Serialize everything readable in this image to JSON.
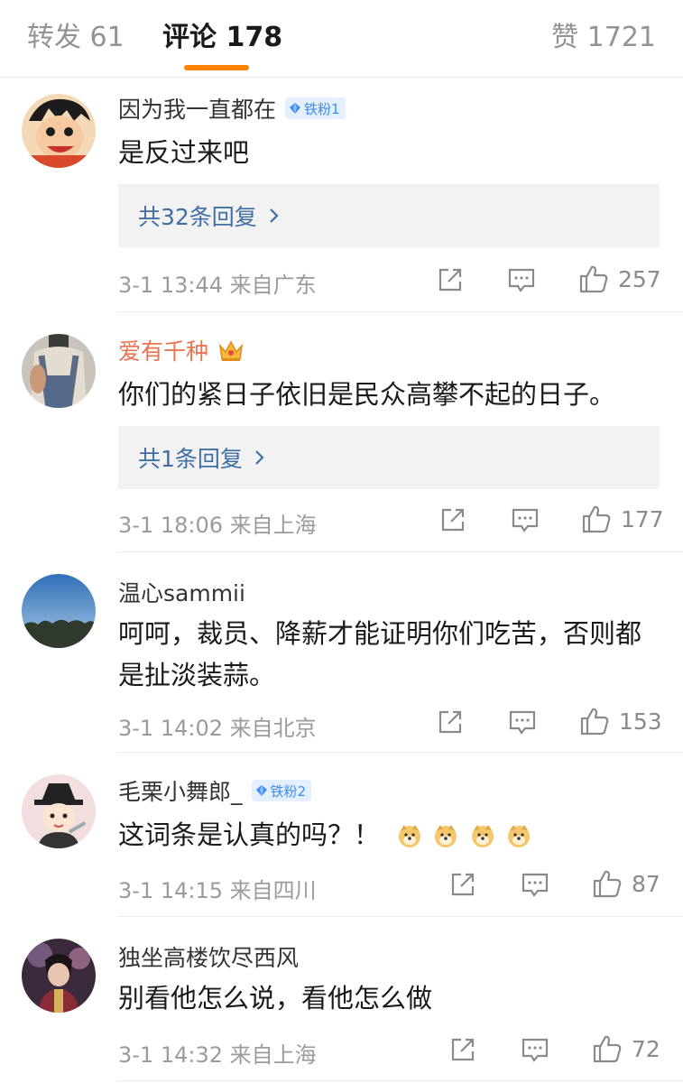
{
  "tabs": {
    "repost": "转发 61",
    "comment": "评论 178",
    "like": "赞 1721"
  },
  "colors": {
    "accent": "#ff8200",
    "link": "#3f6fa4",
    "vip_name": "#eb7350",
    "badge_text": "#3a8bf3",
    "muted": "#9b9b9b"
  },
  "comments": [
    {
      "name": "因为我一直都在",
      "badge": "铁粉1",
      "text": "是反过来吧",
      "reply_link": "共32条回复",
      "time": "3-1 13:44",
      "location": "来自广东",
      "likes": "257",
      "avatar_icon": "cartoon-boy-avatar"
    },
    {
      "name": "爱有千种",
      "badge_icon": "crown-icon",
      "text": "你们的紧日子依旧是民众高攀不起的日子。",
      "reply_link": "共1条回复",
      "time": "3-1 18:06",
      "location": "来自上海",
      "likes": "177",
      "avatar_icon": "person-photo-avatar"
    },
    {
      "name": "温心sammii",
      "text": "呵呵，裁员、降薪才能证明你们吃苦，否则都是扯淡装蒜。",
      "time": "3-1 14:02",
      "location": "来自北京",
      "likes": "153",
      "avatar_icon": "sky-landscape-avatar"
    },
    {
      "name": "毛栗小舞郎_",
      "badge": "铁粉2",
      "text": "这词条是认真的吗？！",
      "emojis": [
        "doge-emoji",
        "doge-emoji",
        "doge-emoji",
        "doge-emoji"
      ],
      "time": "3-1 14:15",
      "location": "来自四川",
      "likes": "87",
      "avatar_icon": "cartoon-hat-avatar"
    },
    {
      "name": "独坐高楼饮尽西风",
      "text": "别看他怎么说，看他怎么做",
      "time": "3-1 14:32",
      "location": "来自上海",
      "likes": "72",
      "avatar_icon": "game-character-avatar"
    }
  ]
}
